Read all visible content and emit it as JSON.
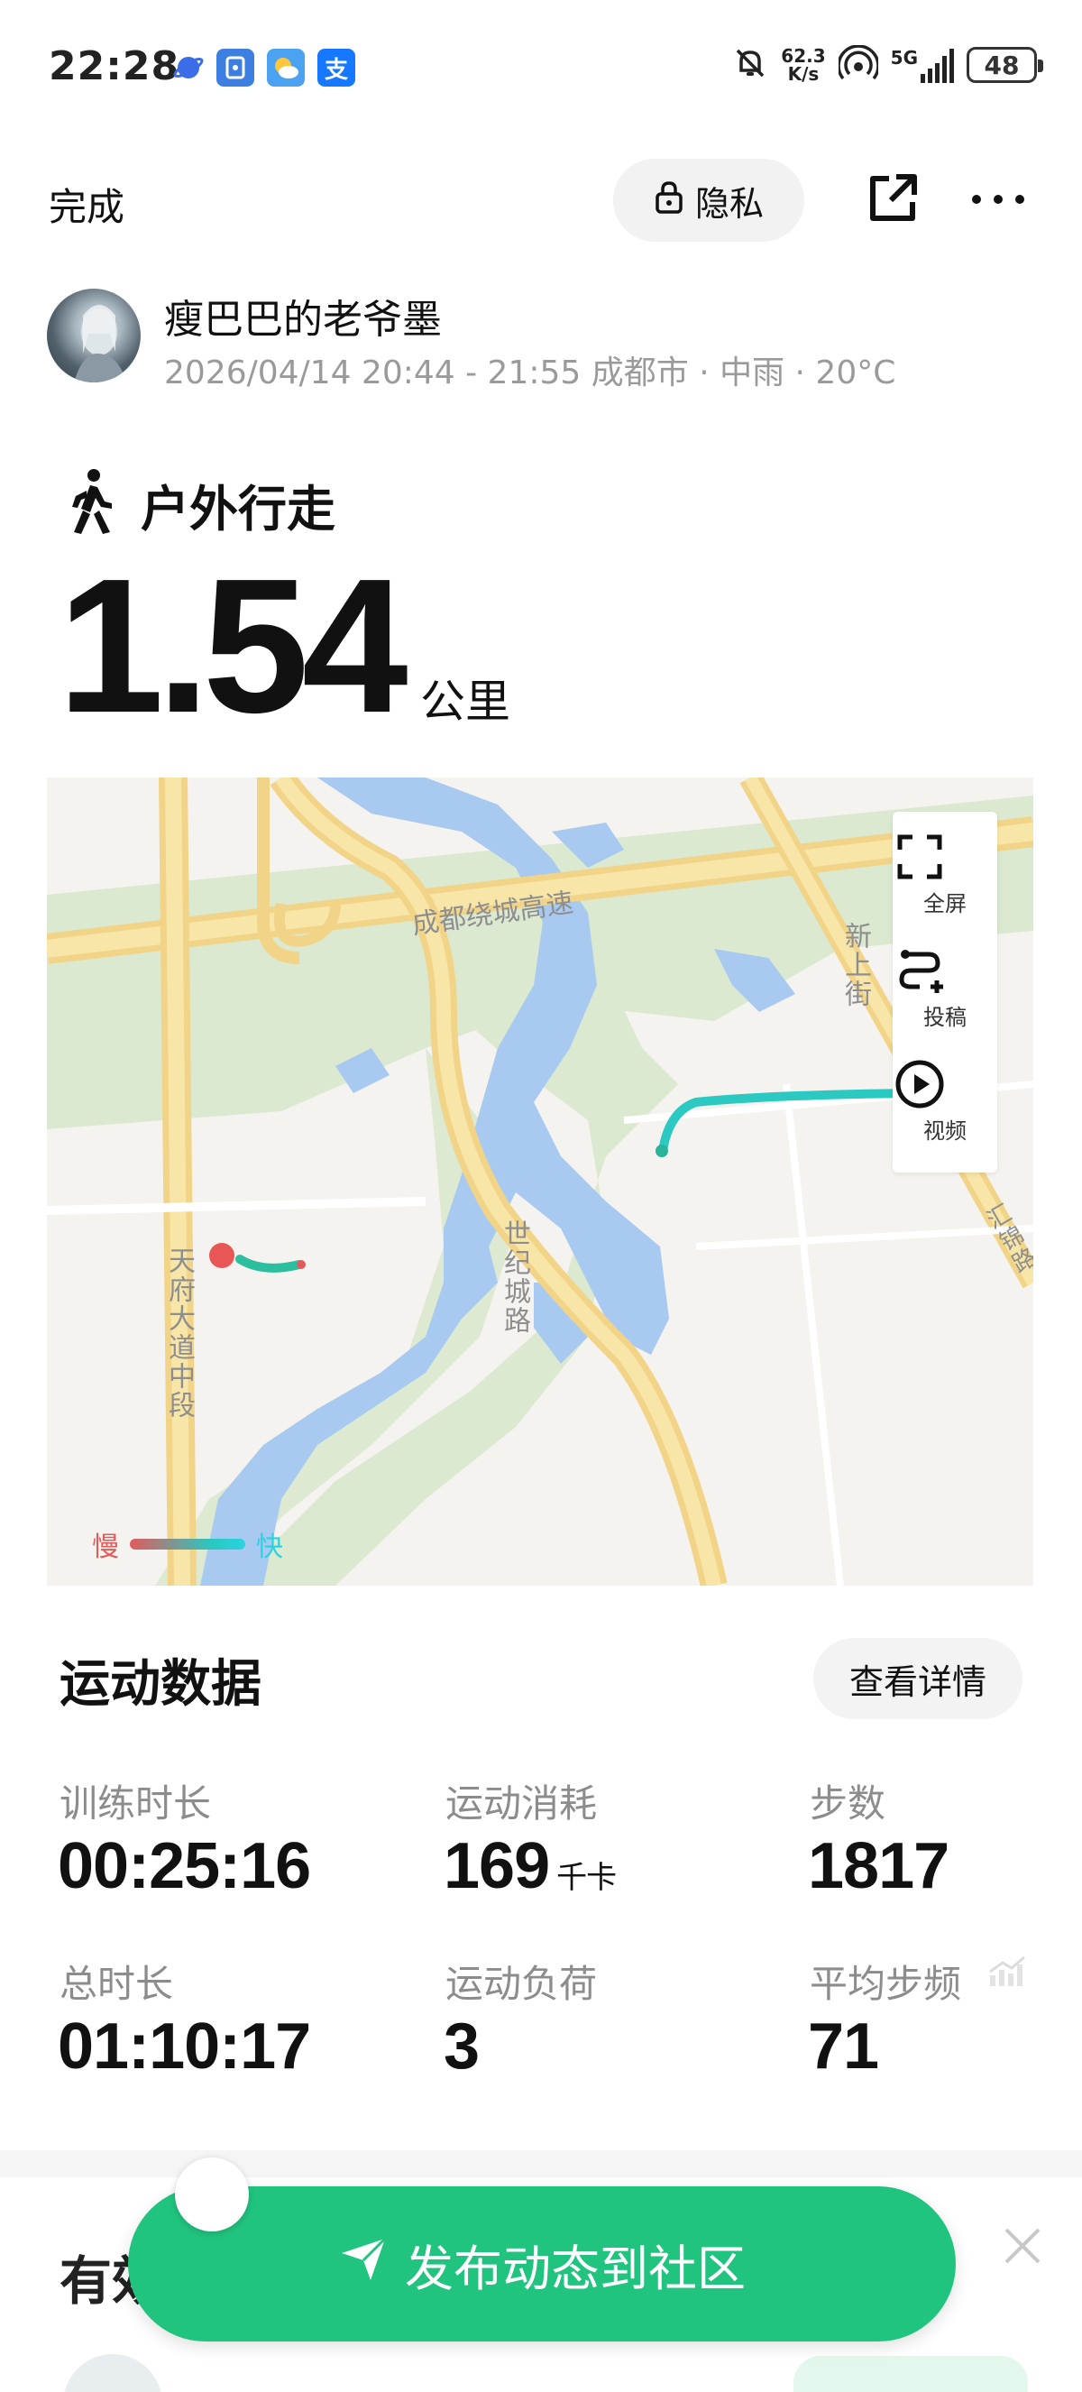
{
  "status_bar": {
    "time": "22:28",
    "net_speed_value": "62.3",
    "net_speed_unit": "K/s",
    "battery": "48",
    "signal_label": "5G"
  },
  "header": {
    "done_label": "完成",
    "privacy_label": "隐私"
  },
  "user": {
    "name": "瘦巴巴的老爷墨",
    "session_meta": "2026/04/14 20:44 - 21:55 成都市 · 中雨 · 20°C"
  },
  "activity": {
    "type": "户外行走",
    "distance": "1.54",
    "distance_unit": "公里"
  },
  "map": {
    "labels": {
      "expressway": "成都绕城高速",
      "tianfu": "天府大道中段",
      "shiji": "世纪城路",
      "xinshang": "新上街",
      "edge": "汇锦路"
    },
    "tools": {
      "fullscreen": "全屏",
      "submit": "投稿",
      "video": "视频"
    },
    "legend": {
      "slow": "慢",
      "fast": "快"
    },
    "colors": {
      "slow": "#e25b5b",
      "fast": "#2ad3e0",
      "water": "#a8c9f0",
      "green": "#d9e8cf",
      "road": "#f7dc8c"
    }
  },
  "stats": {
    "title": "运动数据",
    "details_label": "查看详情",
    "items": [
      {
        "label": "训练时长",
        "value": "00:25:16",
        "unit": ""
      },
      {
        "label": "运动消耗",
        "value": "169",
        "unit": "千卡"
      },
      {
        "label": "步数",
        "value": "1817",
        "unit": ""
      },
      {
        "label": "总时长",
        "value": "01:10:17",
        "unit": ""
      },
      {
        "label": "运动负荷",
        "value": "3",
        "unit": ""
      },
      {
        "label": "平均步频",
        "value": "71",
        "unit": ""
      }
    ]
  },
  "bottom": {
    "partial_title": "有效",
    "publish_label": "发布动态到社区"
  }
}
